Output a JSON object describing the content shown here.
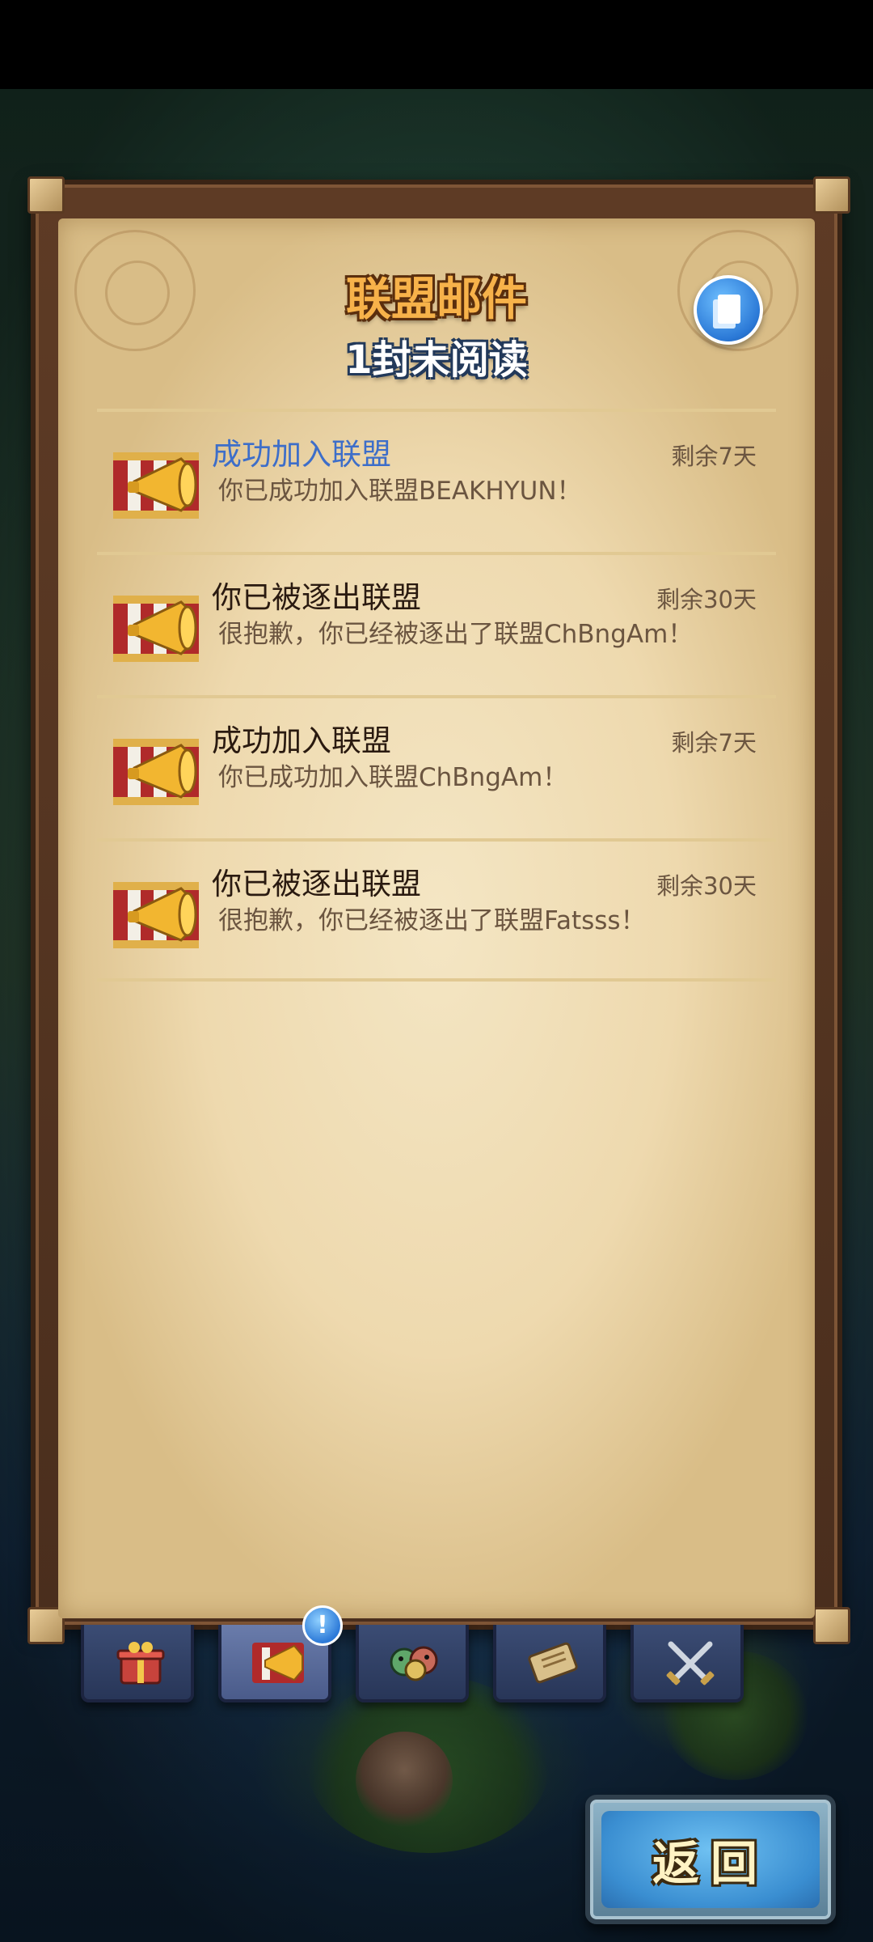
{
  "header": {
    "title": "联盟邮件",
    "unread_text": "1封未阅读",
    "read_all_icon": "documents-icon"
  },
  "mails": [
    {
      "title": "成功加入联盟",
      "body": "你已成功加入联盟BEAKHYUN！",
      "expiry": "剩余7天",
      "unread": true,
      "icon": "horn-banner-icon"
    },
    {
      "title": "你已被逐出联盟",
      "body": "很抱歉，你已经被逐出了联盟ChBngAm！",
      "expiry": "剩余30天",
      "unread": false,
      "icon": "horn-banner-icon"
    },
    {
      "title": "成功加入联盟",
      "body": "你已成功加入联盟ChBngAm！",
      "expiry": "剩余7天",
      "unread": false,
      "icon": "horn-banner-icon"
    },
    {
      "title": "你已被逐出联盟",
      "body": "很抱歉，你已经被逐出了联盟Fatsss！",
      "expiry": "剩余30天",
      "unread": false,
      "icon": "horn-banner-icon"
    }
  ],
  "tabs": [
    {
      "icon": "gift-icon",
      "active": false
    },
    {
      "icon": "alliance-horn-icon",
      "active": true
    },
    {
      "icon": "monsters-icon",
      "active": false
    },
    {
      "icon": "scroll-icon",
      "active": false
    },
    {
      "icon": "crossed-swords-icon",
      "active": false
    }
  ],
  "tab_badge": "!",
  "return_button": {
    "label": "返回"
  },
  "colors": {
    "unread_title": "#3d6ec9",
    "title_orange": "#f7b24a",
    "parchment": "#eed9ae"
  }
}
